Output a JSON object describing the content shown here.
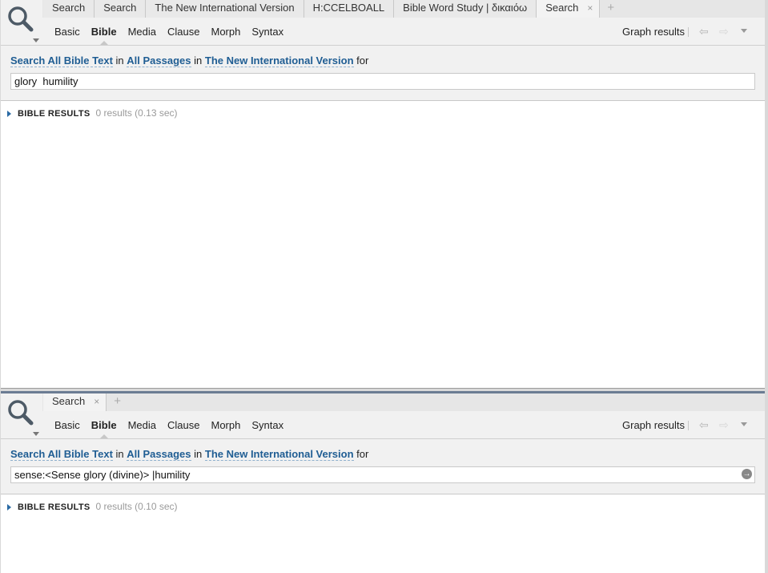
{
  "top": {
    "tabs": [
      "Search",
      "Search",
      "The New International Version",
      "H:CCELBOALL",
      "Bible Word Study | δικαιόω",
      "Search"
    ],
    "active_tab": "Search",
    "add_tab": "+",
    "close_glyph": "×",
    "modes": [
      "Basic",
      "Bible",
      "Media",
      "Clause",
      "Morph",
      "Syntax"
    ],
    "active_mode": "Bible",
    "graph_results": "Graph results",
    "criteria": {
      "search": "Search",
      "scope": "All Bible Text",
      "in1": "in",
      "passages": "All Passages",
      "in2": "in",
      "version": "The New International Version",
      "for": "for"
    },
    "query": "glory  humility",
    "results_label": "BIBLE RESULTS",
    "results_count": "0 results (0.13 sec)"
  },
  "bottom": {
    "tabs": [
      "Search"
    ],
    "active_tab": "Search",
    "add_tab": "+",
    "close_glyph": "×",
    "modes": [
      "Basic",
      "Bible",
      "Media",
      "Clause",
      "Morph",
      "Syntax"
    ],
    "active_mode": "Bible",
    "graph_results": "Graph results",
    "criteria": {
      "search": "Search",
      "scope": "All Bible Text",
      "in1": "in",
      "passages": "All Passages",
      "in2": "in",
      "version": "The New International Version",
      "for": "for"
    },
    "query": "sense:<Sense glory (divine)> |humility",
    "results_label": "BIBLE RESULTS",
    "results_count": "0 results (0.10 sec)"
  },
  "icons": {
    "search": "magnifier-icon",
    "back": "back-arrow-icon",
    "forward": "forward-arrow-icon",
    "menu": "chevron-down-icon",
    "go": "go-arrow-icon",
    "expand": "expand-triangle-icon"
  },
  "colors": {
    "link": "#1f5d93",
    "results_arrow": "#2a6aa4"
  }
}
